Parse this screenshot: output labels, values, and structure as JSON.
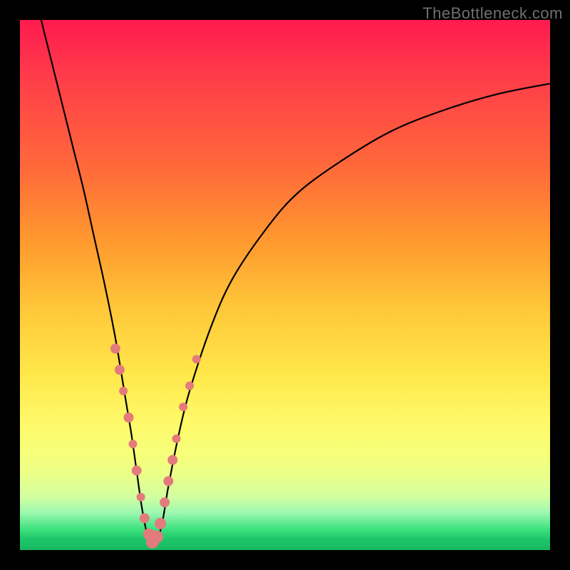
{
  "watermark": "TheBottleneck.com",
  "colors": {
    "frame": "#000000",
    "curve": "#000000",
    "dots": "#e37b7d"
  },
  "chart_data": {
    "type": "line",
    "title": "",
    "xlabel": "",
    "ylabel": "",
    "xlim": [
      0,
      100
    ],
    "ylim": [
      0,
      100
    ],
    "series": [
      {
        "name": "bottleneck-curve",
        "x": [
          4,
          6,
          8,
          10,
          12,
          14,
          16,
          18,
          20,
          21,
          22,
          23,
          24,
          25,
          26,
          27,
          28,
          30,
          32,
          36,
          40,
          46,
          52,
          60,
          70,
          80,
          90,
          100
        ],
        "y": [
          100,
          92,
          84,
          76,
          68,
          59,
          50,
          40,
          28,
          22,
          15,
          8,
          3,
          1,
          2,
          6,
          12,
          22,
          30,
          42,
          51,
          60,
          67,
          73,
          79,
          83,
          86,
          88
        ]
      }
    ],
    "points": {
      "name": "sample-dots",
      "x": [
        18.0,
        18.8,
        19.5,
        20.5,
        21.3,
        22.0,
        22.8,
        23.5,
        24.3,
        25.0,
        25.8,
        26.5,
        27.3,
        28.0,
        28.8,
        29.5,
        30.8,
        32.0,
        33.3
      ],
      "y": [
        38,
        34,
        30,
        25,
        20,
        15,
        10,
        6,
        3,
        1.5,
        2.5,
        5,
        9,
        13,
        17,
        21,
        27,
        31,
        36
      ],
      "r": [
        7,
        7,
        6,
        7,
        6,
        7,
        6,
        7,
        8,
        9,
        9,
        8,
        7,
        7,
        7,
        6,
        6,
        6,
        6
      ]
    }
  }
}
